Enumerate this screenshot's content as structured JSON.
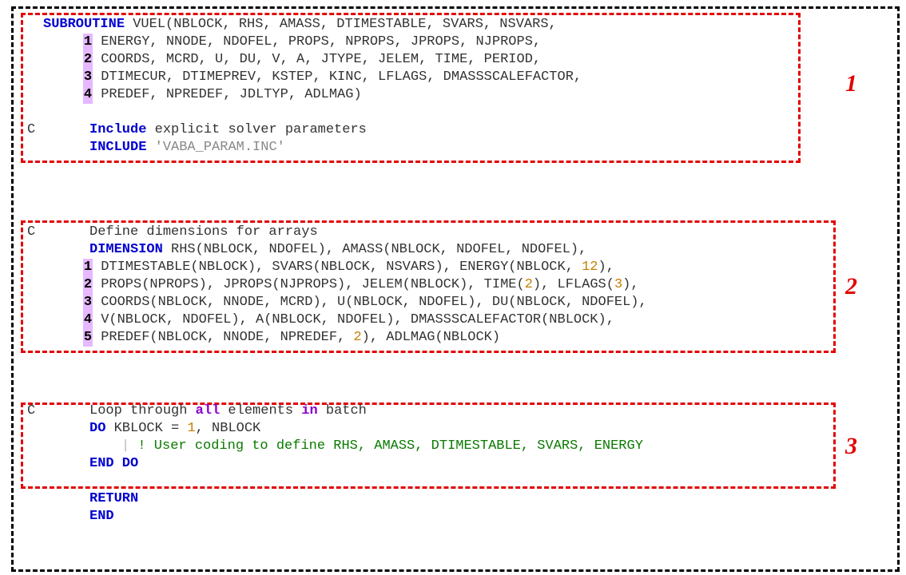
{
  "labels": {
    "s1": "1",
    "s2": "2",
    "s3": "3"
  },
  "c": "C",
  "cont": {
    "n1": "1",
    "n2": "2",
    "n3": "3",
    "n4": "4",
    "n5": "5"
  },
  "l1": {
    "kw": "SUBROUTINE",
    "rest": " VUEL(NBLOCK, RHS, AMASS, DTIMESTABLE, SVARS, NSVARS,"
  },
  "l2": " ENERGY, NNODE, NDOFEL, PROPS, NPROPS, JPROPS, NJPROPS,",
  "l3": " COORDS, MCRD, U, DU, V, A, JTYPE, JELEM, TIME, PERIOD,",
  "l4": " DTIMECUR, DTIMEPREV, KSTEP, KINC, LFLAGS, DMASSSCALEFACTOR,",
  "l5": " PREDEF, NPREDEF, JDLTYP, ADLMAG)",
  "l7a": "Include",
  "l7b": " explicit solver parameters",
  "l8a": "INCLUDE",
  "l8b": " 'VABA_PARAM.INC'",
  "l10": "Define dimensions for arrays",
  "l11a": "DIMENSION",
  "l11b": " RHS(NBLOCK, NDOFEL), AMASS(NBLOCK, NDOFEL, NDOFEL),",
  "l12a": " DTIMESTABLE(NBLOCK), SVARS(NBLOCK, NSVARS), ENERGY(NBLOCK, ",
  "l12n": "12",
  "l12b": "),",
  "l13a": " PROPS(NPROPS), JPROPS(NJPROPS), JELEM(NBLOCK), TIME(",
  "l13n": "2",
  "l13b": "), LFLAGS(",
  "l13n2": "3",
  "l13c": "),",
  "l14": " COORDS(NBLOCK, NNODE, MCRD), U(NBLOCK, NDOFEL), DU(NBLOCK, NDOFEL),",
  "l15": " V(NBLOCK, NDOFEL), A(NBLOCK, NDOFEL), DMASSSCALEFACTOR(NBLOCK),",
  "l16a": " PREDEF(NBLOCK, NNODE, NPREDEF, ",
  "l16n": "2",
  "l16b": "), ADLMAG(NBLOCK)",
  "l18a": "Loop through ",
  "l18b": "all",
  "l18c": " elements ",
  "l18d": "in",
  "l18e": " batch",
  "l19a": "DO",
  "l19b": " KBLOCK ",
  "l19eq": "=",
  "l19sp": " ",
  "l19n": "1",
  "l19c": ", NBLOCK",
  "bar": "|",
  "l20": " ! User coding to define RHS, AMASS, DTIMESTABLE, SVARS, ENERGY",
  "l21": "END DO",
  "l23": "RETURN",
  "l24": "END"
}
